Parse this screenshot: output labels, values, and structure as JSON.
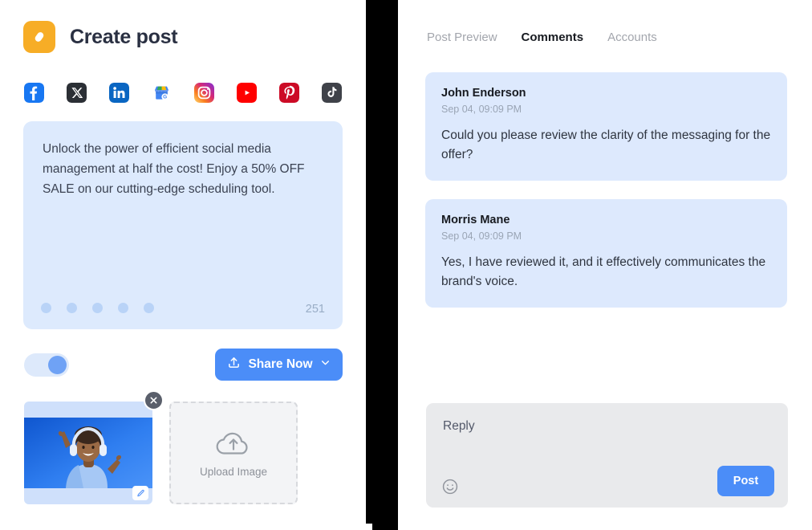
{
  "colors": {
    "accent_blue": "#4b8df8",
    "composer_bg": "#ddeafd",
    "comment_bg": "#dde9fd",
    "reply_bg": "#e9eaec",
    "logo_orange": "#f7ad26",
    "title_text": "#2a3042"
  },
  "left": {
    "logo_icon": "pencil-edit-icon",
    "title": "Create post",
    "networks": [
      {
        "name": "facebook",
        "label": "Facebook"
      },
      {
        "name": "x-twitter",
        "label": "X"
      },
      {
        "name": "linkedin",
        "label": "LinkedIn"
      },
      {
        "name": "google-business",
        "label": "Google Business Profile"
      },
      {
        "name": "instagram",
        "label": "Instagram"
      },
      {
        "name": "youtube",
        "label": "YouTube"
      },
      {
        "name": "pinterest",
        "label": "Pinterest"
      },
      {
        "name": "tiktok",
        "label": "TikTok"
      }
    ],
    "composer": {
      "text": "Unlock the power of efficient social media management at half the cost!  Enjoy a 50% OFF SALE on our cutting-edge scheduling tool.",
      "char_count": "251",
      "toolbar_dot_count": 5
    },
    "schedule_toggle": {
      "state": "on",
      "icon": "toggle-switch"
    },
    "share_button": {
      "label": "Share Now",
      "icon": "upload-icon",
      "chevron": "chevron-down-icon"
    },
    "media": {
      "thumbnail": {
        "alt": "person in blue shirt with headphones cheering",
        "close_icon": "close-icon",
        "edit_icon": "pencil-icon"
      },
      "upload": {
        "label": "Upload Image",
        "icon": "cloud-upload-icon"
      }
    }
  },
  "right": {
    "tabs": [
      {
        "label": "Post Preview",
        "active": false
      },
      {
        "label": "Comments",
        "active": true
      },
      {
        "label": "Accounts",
        "active": false
      }
    ],
    "comments": [
      {
        "author": "John Enderson",
        "time": "Sep 04, 09:09 PM",
        "body": "Could you please review the clarity of the messaging for the offer?"
      },
      {
        "author": "Morris Mane",
        "time": "Sep 04, 09:09 PM",
        "body": "Yes, I have reviewed it, and it effectively communicates the brand's voice."
      }
    ],
    "reply": {
      "placeholder": "Reply",
      "value": "",
      "emoji_icon": "smiley-icon",
      "post_label": "Post"
    }
  }
}
